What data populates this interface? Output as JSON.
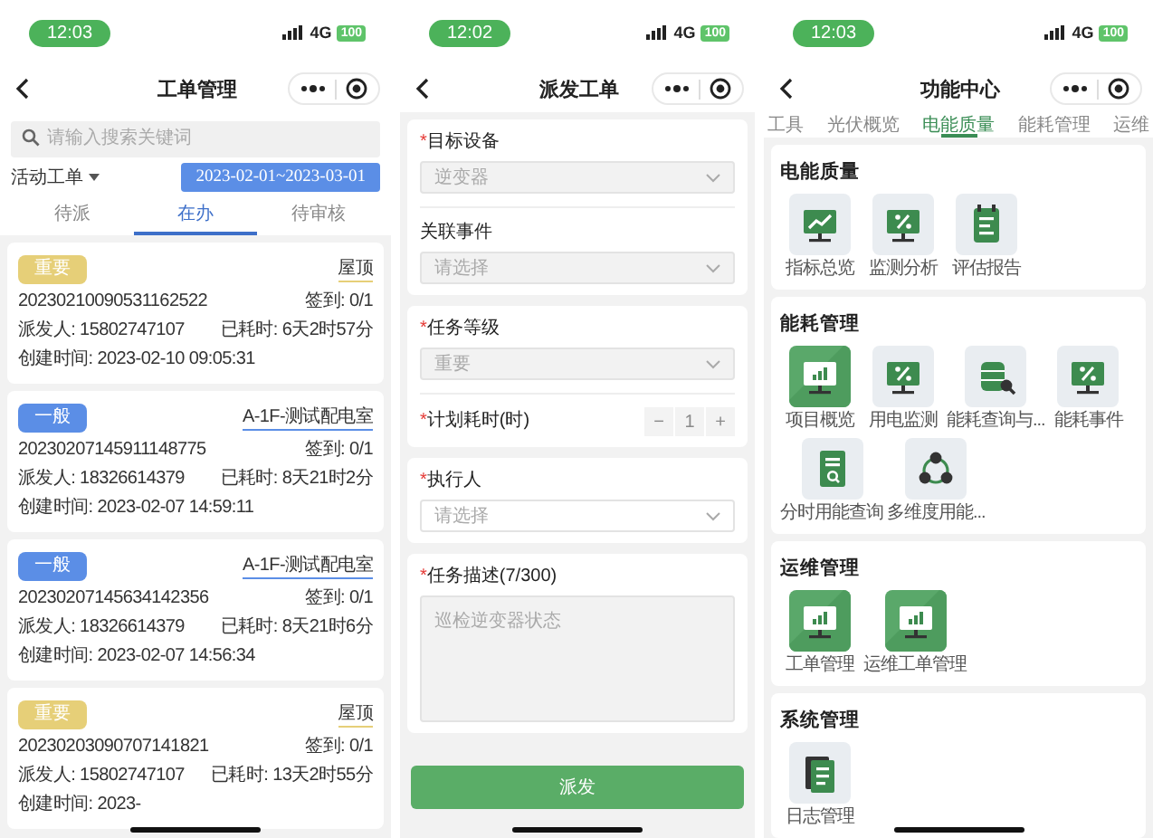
{
  "screens": [
    {
      "kind": "orders",
      "status_bar": {
        "time": "12:03",
        "network": "4G",
        "battery": "100"
      },
      "title": "工单管理",
      "search": {
        "placeholder": "请输入搜索关键词"
      },
      "filter": {
        "label": "活动工单"
      },
      "date_range": "2023-02-01~2023-03-01",
      "tabs": [
        {
          "label": "待派",
          "selected": false
        },
        {
          "label": "在办",
          "selected": true
        },
        {
          "label": "待审核",
          "selected": false
        }
      ],
      "orders": [
        {
          "priority": "重要",
          "color": "#e6cf78",
          "location": "屋顶",
          "number": "20230210090531162522",
          "sign_in": "签到: 0/1",
          "dispatcher": "派发人: 15802747107",
          "elapsed": "已耗时: 6天2时57分",
          "created": "创建时间: 2023-02-10 09:05:31"
        },
        {
          "priority": "一般",
          "color": "#5b8ee6",
          "location": "A-1F-测试配电室",
          "number": "20230207145911148775",
          "sign_in": "签到: 0/1",
          "dispatcher": "派发人: 18326614379",
          "elapsed": "已耗时: 8天21时2分",
          "created": "创建时间: 2023-02-07 14:59:11"
        },
        {
          "priority": "一般",
          "color": "#5b8ee6",
          "location": "A-1F-测试配电室",
          "number": "20230207145634142356",
          "sign_in": "签到: 0/1",
          "dispatcher": "派发人: 18326614379",
          "elapsed": "已耗时: 8天21时6分",
          "created": "创建时间: 2023-02-07 14:56:34"
        },
        {
          "priority": "重要",
          "color": "#e6cf78",
          "location": "屋顶",
          "number": "20230203090707141821",
          "sign_in": "签到: 0/1",
          "dispatcher": "派发人: 15802747107",
          "elapsed": "已耗时: 13天2时55分",
          "created": "创建时间: 2023-"
        }
      ]
    },
    {
      "kind": "dispatch",
      "status_bar": {
        "time": "12:02",
        "network": "4G",
        "battery": "100"
      },
      "title": "派发工单",
      "groups": [
        {
          "fields": [
            {
              "kind": "select",
              "required_mark": "*",
              "label": "目标设备",
              "value": "逆变器",
              "disabled": true
            },
            {
              "kind": "select",
              "label": "关联事件",
              "placeholder": "请选择",
              "disabled": true
            }
          ]
        },
        {
          "fields": [
            {
              "kind": "select",
              "required_mark": "*",
              "label": "任务等级",
              "value": "重要",
              "disabled": true
            },
            {
              "kind": "stepper",
              "required_mark": "*",
              "label": "计划耗时(时)",
              "minus": "−",
              "value": "1",
              "plus": "+",
              "disabled": true
            }
          ]
        },
        {
          "fields": [
            {
              "kind": "select",
              "required_mark": "*",
              "label": "执行人",
              "placeholder": "请选择",
              "disabled": false
            }
          ]
        },
        {
          "fields": [
            {
              "kind": "textarea",
              "required_mark": "*",
              "label": "任务描述(7/300)",
              "value": "巡检逆变器状态",
              "disabled": true
            }
          ]
        }
      ],
      "submit": "派发"
    },
    {
      "kind": "functions",
      "status_bar": {
        "time": "12:03",
        "network": "4G",
        "battery": "100"
      },
      "title": "功能中心",
      "tabs": [
        {
          "label": "工具",
          "selected": false
        },
        {
          "label": "光伏概览",
          "selected": false
        },
        {
          "label": "电能质量",
          "selected": true
        },
        {
          "label": "能耗管理",
          "selected": false
        },
        {
          "label": "运维",
          "selected": false
        }
      ],
      "sections": [
        {
          "title": "电能质量",
          "items": [
            {
              "kind": "trend",
              "label": "指标总览"
            },
            {
              "kind": "percent",
              "label": "监测分析"
            },
            {
              "kind": "report",
              "label": "评估报告"
            }
          ]
        },
        {
          "title": "能耗管理",
          "items": [
            {
              "kind": "bars",
              "label": "项目概览"
            },
            {
              "kind": "percent",
              "label": "用电监测"
            },
            {
              "kind": "database",
              "label": "能耗查询与..."
            },
            {
              "kind": "percent",
              "label": "能耗事件"
            },
            {
              "kind": "search-doc",
              "label": "分时用能查询"
            },
            {
              "kind": "network",
              "label": "多维度用能..."
            }
          ]
        },
        {
          "title": "运维管理",
          "items": [
            {
              "kind": "bars",
              "label": "工单管理"
            },
            {
              "kind": "bars",
              "label": "运维工单管理"
            }
          ]
        },
        {
          "title": "系统管理",
          "items": [
            {
              "kind": "docs",
              "label": "日志管理"
            }
          ]
        }
      ]
    }
  ]
}
